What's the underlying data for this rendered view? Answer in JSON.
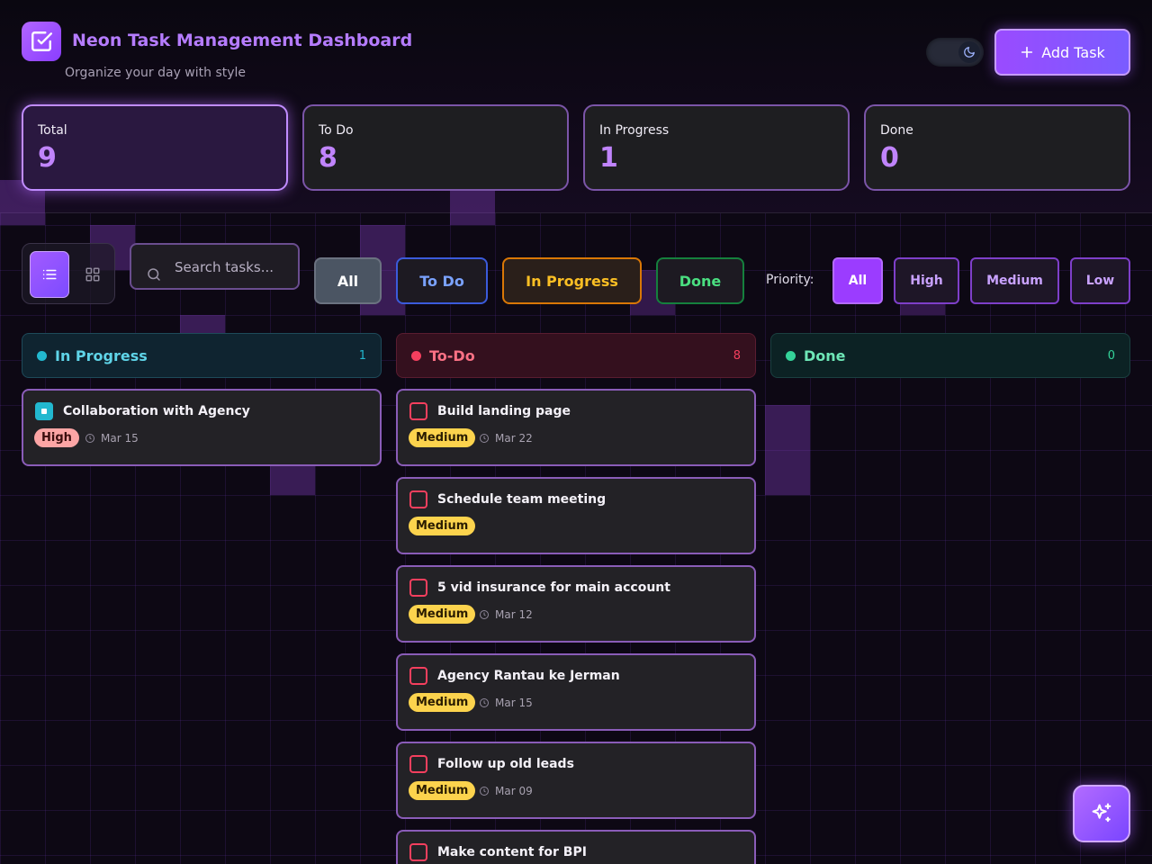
{
  "header": {
    "title": "Neon Task Management Dashboard",
    "subtitle": "Organize your day with style",
    "add_task_label": "Add Task",
    "app_icon": "checkbox-icon",
    "theme_icon": "moon-icon"
  },
  "stats": [
    {
      "label": "Total",
      "value": "9"
    },
    {
      "label": "To Do",
      "value": "8"
    },
    {
      "label": "In Progress",
      "value": "1"
    },
    {
      "label": "Done",
      "value": "0"
    }
  ],
  "toolbar": {
    "search_placeholder": "Search tasks...",
    "status_filters": [
      "All",
      "To Do",
      "In Progress",
      "Done"
    ],
    "priority_label": "Priority:",
    "priority_filters": [
      "All",
      "High",
      "Medium",
      "Low"
    ]
  },
  "columns": {
    "in_progress": {
      "name": "In Progress",
      "count": "1",
      "tasks": [
        {
          "title": "Collaboration with Agency",
          "priority": "High",
          "date": "Mar 15"
        }
      ]
    },
    "todo": {
      "name": "To-Do",
      "count": "8",
      "tasks": [
        {
          "title": "Build landing page",
          "priority": "Medium",
          "date": "Mar 22"
        },
        {
          "title": "Schedule team meeting",
          "priority": "Medium",
          "date": ""
        },
        {
          "title": "5 vid insurance for main account",
          "priority": "Medium",
          "date": "Mar 12"
        },
        {
          "title": "Agency Rantau ke Jerman",
          "priority": "Medium",
          "date": "Mar 15"
        },
        {
          "title": "Follow up old leads",
          "priority": "Medium",
          "date": "Mar 09"
        },
        {
          "title": "Make content for BPI",
          "priority": "",
          "date": ""
        }
      ]
    },
    "done": {
      "name": "Done",
      "count": "0",
      "tasks": []
    }
  },
  "colors": {
    "accent": "#b57cff",
    "in_progress": "#22b8cf",
    "todo": "#f43f5e",
    "done": "#34d399",
    "medium_badge": "#fcd34d",
    "high_badge": "#fca5a5"
  }
}
